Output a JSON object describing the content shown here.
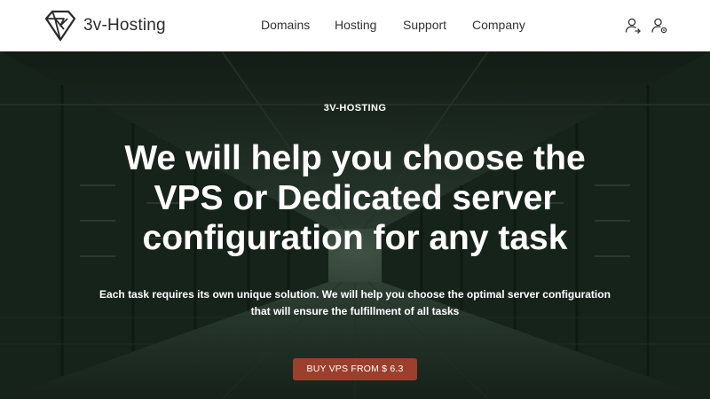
{
  "header": {
    "logo_text": "3v-Hosting",
    "logo_icon": "diamond-logo-icon",
    "nav": [
      {
        "label": "Domains"
      },
      {
        "label": "Hosting"
      },
      {
        "label": "Support"
      },
      {
        "label": "Company"
      }
    ],
    "icons": [
      "user-add-icon",
      "user-settings-icon"
    ]
  },
  "hero": {
    "eyebrow": "3V-HOSTING",
    "headline": "We will help you choose the VPS or Dedicated server configuration for any task",
    "subtext": "Each task requires its own unique solution. We will help you choose the optimal server configuration that will ensure the fulfillment of all tasks",
    "cta_label": "BUY VPS FROM $ 6.3",
    "background": "server-room-corridor-image"
  },
  "colors": {
    "header_bg": "#ffffff",
    "hero_tint": "#1a2a1f",
    "cta_bg": "#9c3f2c",
    "text_light": "#ffffff",
    "text_dark": "#333333"
  }
}
